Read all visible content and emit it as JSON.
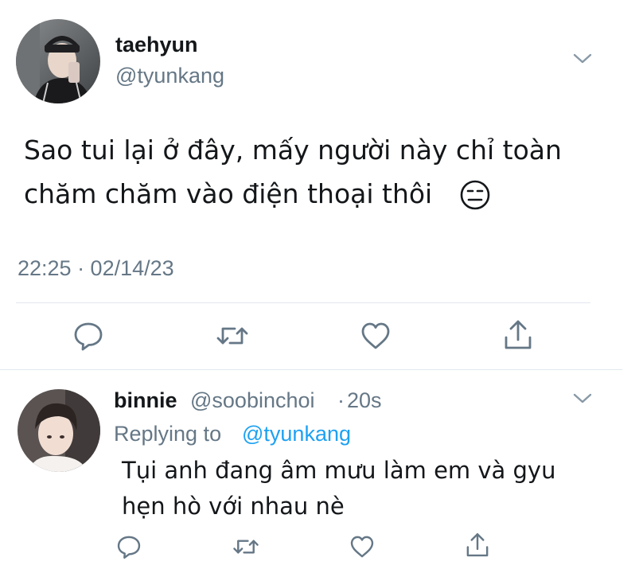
{
  "tweet": {
    "display_name": "taehyun",
    "handle": "@tyunkang",
    "text_line1": "Sao tui lại ở đây, mấy người này chỉ toàn",
    "text_line2": "chăm chăm vào điện thoại thôi",
    "emoji": "expressionless-face-emoji",
    "timestamp": "22:25 · 02/14/23",
    "actions": [
      "reply-icon",
      "retweet-icon",
      "like-icon",
      "share-icon"
    ]
  },
  "reply": {
    "display_name": "binnie",
    "handle": "@soobinchoi",
    "dot": "·",
    "age": "20s",
    "replying_prefix": "Replying to",
    "replying_handle": "@tyunkang",
    "text_line1": "Tụi anh đang âm mưu làm em và gyu",
    "text_line2": "hẹn hò với nhau nè",
    "actions": [
      "reply-icon",
      "retweet-icon",
      "like-icon",
      "share-icon"
    ]
  },
  "colors": {
    "text": "#14171a",
    "secondary": "#657786",
    "link": "#1da1f2",
    "divider": "#e1e8ed"
  }
}
